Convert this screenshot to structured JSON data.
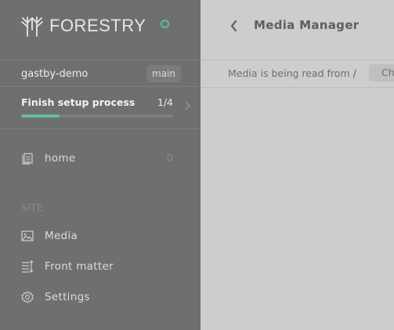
{
  "brand": {
    "name": "FORESTRY",
    "logo_icon": "forestry-trees-logo"
  },
  "status": {
    "icon": "status-ring-icon",
    "color": "#5fbf9a"
  },
  "site": {
    "name": "gastby-demo",
    "branch": "main"
  },
  "setup": {
    "title": "Finish setup process",
    "progress_text": "1/4",
    "progress_fraction": 0.25
  },
  "nav": {
    "home": {
      "label": "home",
      "count": "0",
      "icon": "document-stack-icon"
    },
    "section_label": "SITE",
    "media": {
      "label": "Media",
      "icon": "image-icon"
    },
    "front_matter": {
      "label": "Front matter",
      "icon": "front-matter-icon"
    },
    "settings": {
      "label": "Settings",
      "icon": "gear-icon"
    }
  },
  "header": {
    "title": "Media Manager",
    "back_icon": "chevron-left-icon"
  },
  "media_source": {
    "text": "Media is being read from",
    "path": "/",
    "button_label": "Ch"
  },
  "colors": {
    "accent": "#5fbf9a",
    "sidebar": "#6f6f6f",
    "main": "#cdcdcd"
  }
}
